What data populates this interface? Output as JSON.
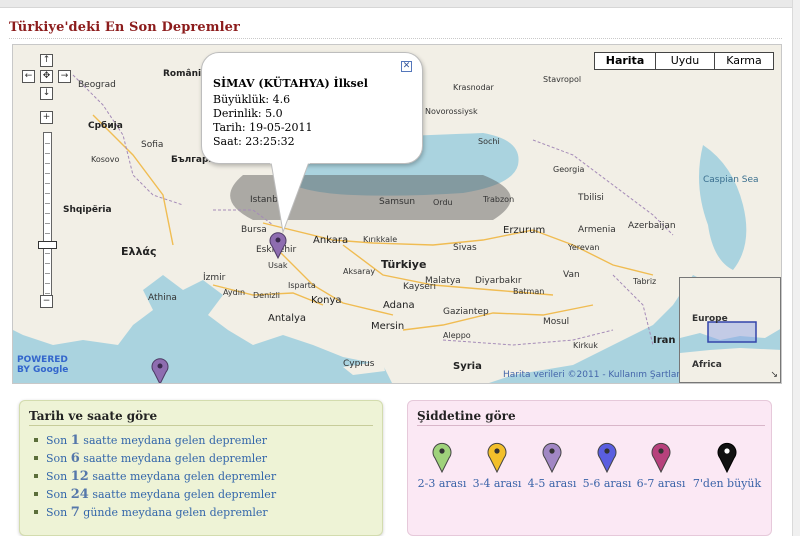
{
  "page": {
    "title": "Türkiye'deki En Son Depremler"
  },
  "map": {
    "types": [
      "Harita",
      "Uydu",
      "Karma"
    ],
    "active_type": "Harita",
    "infowindow": {
      "title": "SİMAV (KÜTAHYA) İlksel",
      "magnitude": "Büyüklük: 4.6",
      "depth": "Derinlik: 5.0",
      "date": "Tarih: 19-05-2011",
      "time": "Saat: 23:25:32",
      "close": "✕"
    },
    "labels": {
      "countries": [
        "Türkiye",
        "Ελλάς",
        "Shqipëria",
        "Србија",
        "България",
        "România",
        "Kosovo",
        "Azerbaijan",
        "Armenia",
        "Georgia",
        "Syria",
        "Iran",
        "Cyprus"
      ],
      "cities": [
        "Beograd",
        "Sofia",
        "Istanbul",
        "Bursa",
        "Eskişehir",
        "Ankara",
        "Kırıkkale",
        "Samsun",
        "Ordu",
        "Trabzon",
        "Erzurum",
        "Sivas",
        "Kayseri",
        "İzmir",
        "Aydın",
        "Antalya",
        "Konya",
        "Adana",
        "Mersin",
        "Malatya",
        "Diyarbakır",
        "Gaziantep",
        "Van",
        "Mosul",
        "Athina",
        "Tbilisi",
        "Sochi",
        "Yerevan",
        "Krasnodar",
        "Novorossiysk",
        "Stavropol",
        "Usak",
        "Denizli",
        "Isparta",
        "Aksaray",
        "Batman",
        "Tabriz",
        "Kirkuk",
        "Aleppo"
      ],
      "seas": [
        "Caspian Sea"
      ],
      "regions": [
        "Europe",
        "Africa"
      ]
    },
    "attribution": "Harita verileri ©2011 - Kullanım Şartları",
    "logo": "POWERED BY Google",
    "nav": {
      "up": "↑",
      "down": "↓",
      "left": "←",
      "right": "→",
      "center": "✥",
      "zoom_in": "+",
      "zoom_out": "−"
    },
    "pin_color": "#8e6db0"
  },
  "date_filter": {
    "title": "Tarih ve saate göre",
    "items": [
      {
        "prefix": "Son ",
        "num": "1",
        "suffix": " saatte meydana gelen depremler"
      },
      {
        "prefix": "Son ",
        "num": "6",
        "suffix": " saatte meydana gelen depremler"
      },
      {
        "prefix": "Son ",
        "num": "12",
        "suffix": " saatte meydana gelen depremler"
      },
      {
        "prefix": "Son ",
        "num": "24",
        "suffix": " saatte meydana gelen depremler"
      },
      {
        "prefix": "Son ",
        "num": "7",
        "suffix": " günde meydana gelen depremler"
      }
    ]
  },
  "magnitude_filter": {
    "title": "Şiddetine göre",
    "items": [
      {
        "label": "2-3 arası",
        "color": "#9fd27b"
      },
      {
        "label": "3-4 arası",
        "color": "#f2bf2b"
      },
      {
        "label": "4-5 arası",
        "color": "#a187c4"
      },
      {
        "label": "5-6 arası",
        "color": "#5a5ee0"
      },
      {
        "label": "6-7 arası",
        "color": "#b7417c"
      },
      {
        "label": "7'den büyük",
        "color": "#111111"
      }
    ]
  }
}
